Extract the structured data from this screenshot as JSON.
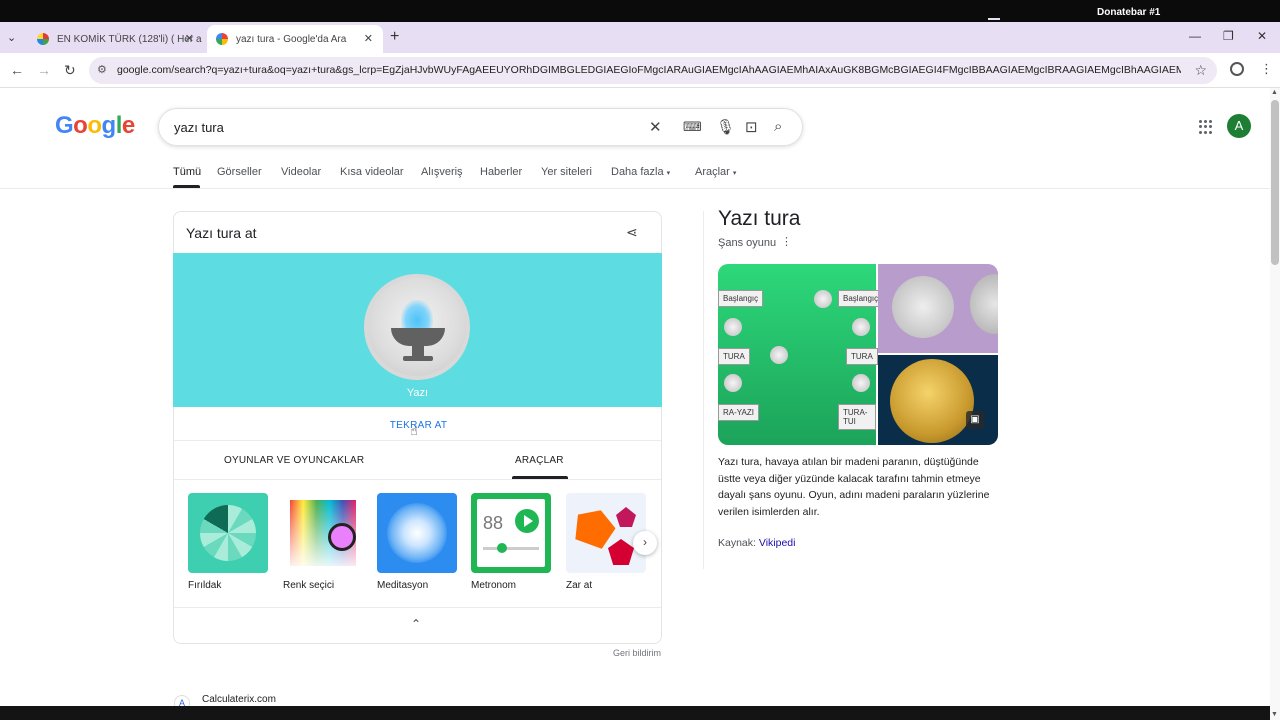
{
  "overlay": {
    "top_label": "Donatebar #1"
  },
  "browser": {
    "tabs": [
      {
        "title": "EN KOMİK TÜRK (128'li) ( Her a",
        "favicon": "colorful-icon",
        "active": false
      },
      {
        "title": "yazı tura - Google'da Ara",
        "favicon": "google-g-icon",
        "active": true
      }
    ],
    "new_tab": "+",
    "url": "google.com/search?q=yazı+tura&oq=yazı+tura&gs_lcrp=EgZjaHJvbWUyFAgAEEUYORhDGIMBGLEDGIAEGIoFMgcIARAuGIAEMgcIAhAAGIAEMhAIAxAuGK8BGMcBGIAEGI4FMgcIBBAAGIAEMgcIBRAAGIAEMgcIBhAAGIAEMgcIBxAA"
  },
  "google": {
    "logo": "Google",
    "query": "yazı tura",
    "nav_tabs": [
      "Tümü",
      "Görseller",
      "Videolar",
      "Kısa videolar",
      "Alışveriş",
      "Haberler",
      "Yer siteleri",
      "Daha fazla",
      "Araçlar"
    ],
    "avatar_letter": "A"
  },
  "coin_card": {
    "title": "Yazı tura at",
    "result": "Yazı",
    "retry_label": "TEKRAR AT",
    "subtabs": [
      "OYUNLAR VE OYUNCAKLAR",
      "ARAÇLAR"
    ],
    "active_subtab": "ARAÇLAR",
    "tools": [
      {
        "label": "Fırıldak"
      },
      {
        "label": "Renk seçici"
      },
      {
        "label": "Meditasyon"
      },
      {
        "label": "Metronom",
        "value": "88"
      },
      {
        "label": "Zar at"
      }
    ],
    "feedback": "Geri bildirim"
  },
  "knowledge_panel": {
    "title": "Yazı tura",
    "subtitle": "Şans oyunu",
    "image_labels": [
      "Başlangıç",
      "Başlangıç",
      "TURA",
      "TURA",
      "RA-YAZI",
      "TURA-TUI"
    ],
    "description": "Yazı tura, havaya atılan bir madeni paranın, düştüğünde üstte veya diğer yüzünde kalacak tarafını tahmin etmeye dayalı şans oyunu. Oyun, adını madeni paraların yüzlerine verilen isimlerden alır.",
    "source_label": "Kaynak:",
    "source_link": "Vikipedi"
  },
  "results": [
    {
      "site": "Calculaterix.com"
    }
  ],
  "colors": {
    "coin_bg": "#5ddde2",
    "link_blue": "#1a73e8",
    "visited_link": "#1a0dab",
    "avatar_bg": "#1e7e34"
  }
}
